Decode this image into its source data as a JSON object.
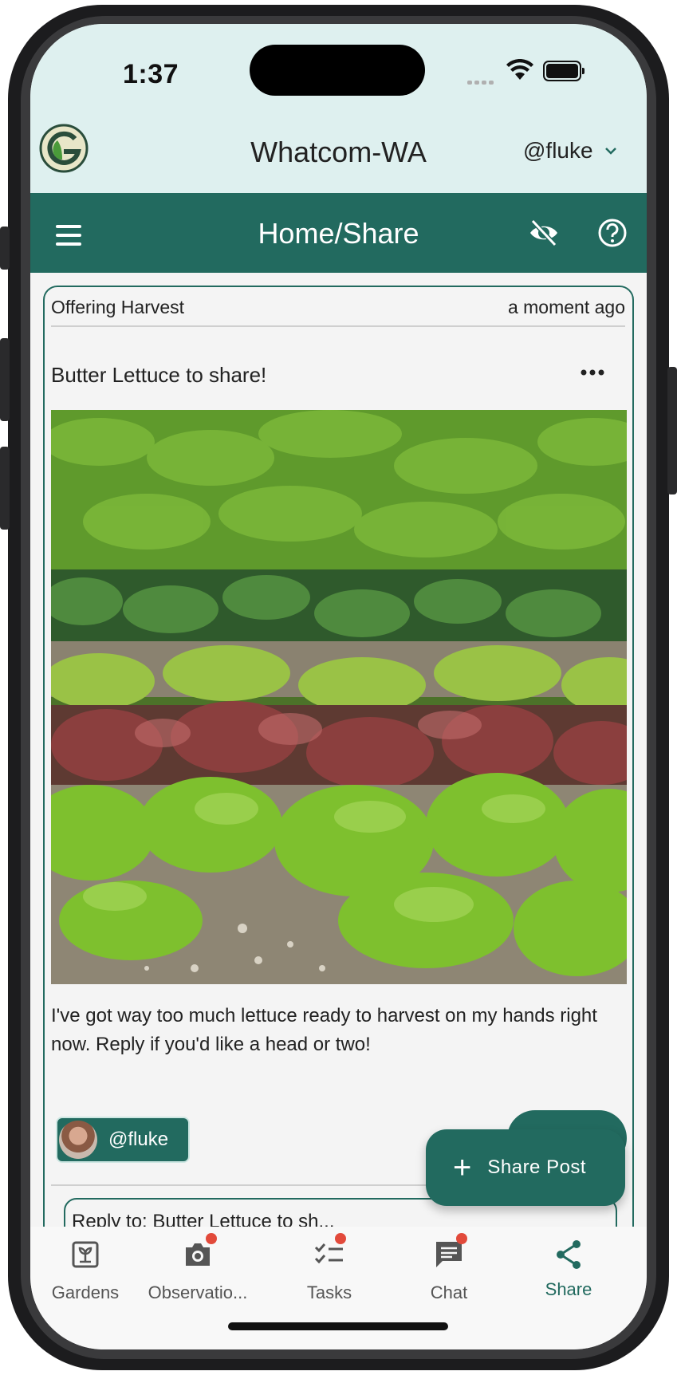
{
  "status_bar": {
    "time": "1:37"
  },
  "header": {
    "org_name": "Whatcom-WA",
    "user": "@fluke"
  },
  "appbar": {
    "title": "Home/Share"
  },
  "post": {
    "category": "Offering Harvest",
    "timestamp": "a moment ago",
    "title": "Butter Lettuce to share!",
    "body": "I've got way too much lettuce ready to harvest on my hands right now. Reply if you'd like a head or two!",
    "author": "@fluke",
    "reply_label": "Reply",
    "reply_preview": "Reply to: Butter Lettuce to sh..."
  },
  "fab": {
    "label": "Share Post"
  },
  "tabs": [
    {
      "label": "Gardens",
      "icon": "gardens-icon",
      "badge": false
    },
    {
      "label": "Observatio...",
      "icon": "camera-icon",
      "badge": true
    },
    {
      "label": "Tasks",
      "icon": "tasks-icon",
      "badge": true
    },
    {
      "label": "Chat",
      "icon": "chat-icon",
      "badge": true
    },
    {
      "label": "Share",
      "icon": "share-icon",
      "badge": false,
      "active": true
    }
  ],
  "colors": {
    "primary": "#226a5f",
    "header_bg": "#def0ef",
    "badge": "#e24a3b"
  }
}
